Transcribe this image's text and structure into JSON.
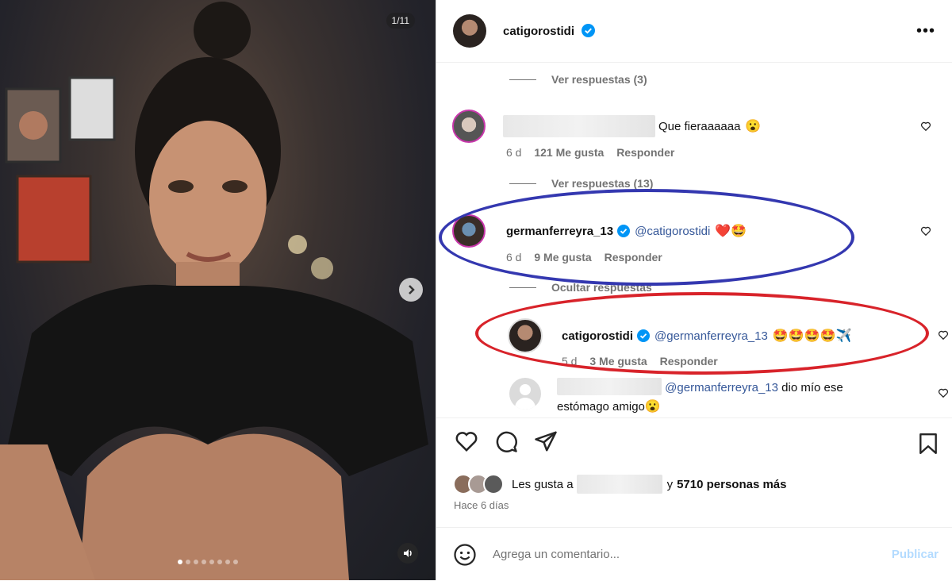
{
  "carousel": {
    "counter": "1/11",
    "dots_total": 8,
    "active_dot": 0
  },
  "post": {
    "author": "catigorostidi",
    "verified": true,
    "more_icon": "more-options-icon"
  },
  "comments": {
    "view_replies_1": "Ver respuestas (3)",
    "c1": {
      "text": "Que fieraaaaaa",
      "emoji": "😮",
      "time": "6 d",
      "likes": "121 Me gusta",
      "reply": "Responder"
    },
    "view_replies_2": "Ver respuestas (13)",
    "c2": {
      "user": "germanferreyra_13",
      "mention": "@catigorostidi",
      "emoji": "❤️🤩",
      "time": "6 d",
      "likes": "9 Me gusta",
      "reply": "Responder"
    },
    "hide_replies": "Ocultar respuestas",
    "r1": {
      "user": "catigorostidi",
      "mention": "@germanferreyra_13",
      "emoji": "🤩🤩🤩🤩✈️",
      "time": "5 d",
      "likes": "3 Me gusta",
      "reply": "Responder"
    },
    "r2": {
      "mention": "@germanferreyra_13",
      "text_1": "dio mío ese",
      "text_2": "estómago amigo",
      "emoji": "😮"
    }
  },
  "likes_bar": {
    "prefix": "Les gusta a",
    "suffix": "y",
    "count": "5710 personas más"
  },
  "posted": "Hace 6 días",
  "add_comment": {
    "placeholder": "Agrega un comentario...",
    "publish": "Publicar"
  },
  "colors": {
    "verified": "#0095f6",
    "mention": "#365899",
    "annotation_blue": "#3438b0",
    "annotation_red": "#d8232a",
    "publish_disabled": "#b3dbff"
  }
}
